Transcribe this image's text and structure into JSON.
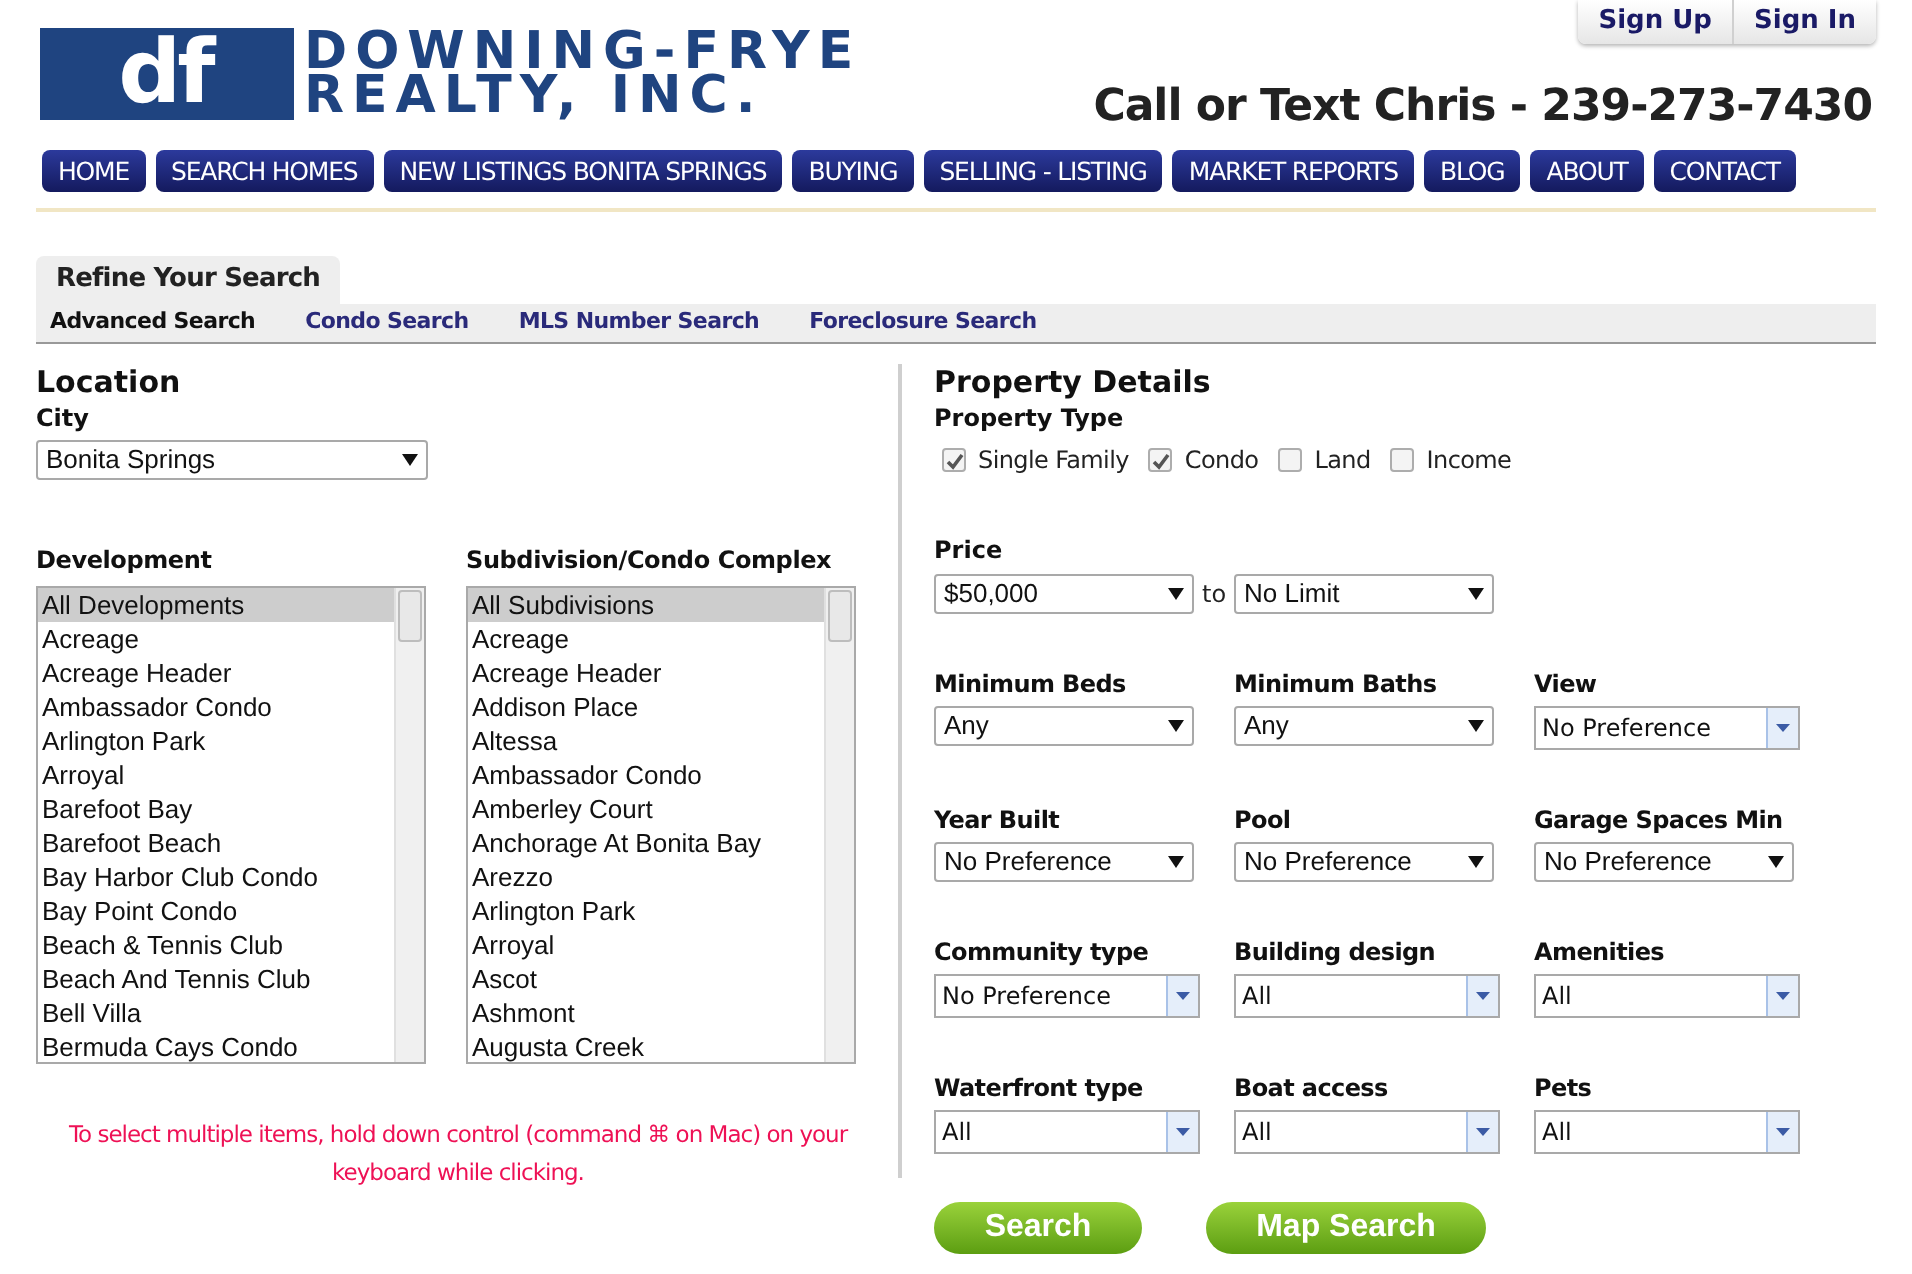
{
  "logo": {
    "mark": "df",
    "name_line_1": "DOWNING-FRYE",
    "name_line_2": "REALTY, INC."
  },
  "account_links": [
    "Sign Up",
    "Sign In"
  ],
  "phone": "Call or Text Chris - 239-273-7430",
  "nav": [
    "HOME",
    "SEARCH HOMES",
    "NEW LISTINGS BONITA SPRINGS",
    "BUYING",
    "SELLING - LISTING",
    "MARKET REPORTS",
    "BLOG",
    "ABOUT",
    "CONTACT"
  ],
  "panel_tab": "Refine Your Search",
  "search_tabs": [
    {
      "label": "Advanced Search",
      "selected": true
    },
    {
      "label": "Condo Search",
      "selected": false
    },
    {
      "label": "MLS Number Search",
      "selected": false
    },
    {
      "label": "Foreclosure Search",
      "selected": false
    }
  ],
  "location": {
    "heading": "Location",
    "city_label": "City",
    "city_value": "Bonita Springs",
    "lists": [
      {
        "label": "Development",
        "items": [
          {
            "text": "All Developments",
            "selected": true
          },
          {
            "text": "Acreage",
            "selected": false
          },
          {
            "text": "Acreage Header",
            "selected": false
          },
          {
            "text": "Ambassador Condo",
            "selected": false
          },
          {
            "text": "Arlington Park",
            "selected": false
          },
          {
            "text": "Arroyal",
            "selected": false
          },
          {
            "text": "Barefoot Bay",
            "selected": false
          },
          {
            "text": "Barefoot Beach",
            "selected": false
          },
          {
            "text": "Bay Harbor Club Condo",
            "selected": false
          },
          {
            "text": "Bay Point Condo",
            "selected": false
          },
          {
            "text": "Beach & Tennis Club",
            "selected": false
          },
          {
            "text": "Beach And Tennis Club",
            "selected": false
          },
          {
            "text": "Bell Villa",
            "selected": false
          },
          {
            "text": "Bermuda Cays Condo",
            "selected": false
          }
        ]
      },
      {
        "label": "Subdivision/Condo Complex",
        "items": [
          {
            "text": "All Subdivisions",
            "selected": true
          },
          {
            "text": "Acreage",
            "selected": false
          },
          {
            "text": "Acreage Header",
            "selected": false
          },
          {
            "text": "Addison Place",
            "selected": false
          },
          {
            "text": "Altessa",
            "selected": false
          },
          {
            "text": "Ambassador Condo",
            "selected": false
          },
          {
            "text": "Amberley Court",
            "selected": false
          },
          {
            "text": "Anchorage At Bonita Bay",
            "selected": false
          },
          {
            "text": "Arezzo",
            "selected": false
          },
          {
            "text": "Arlington Park",
            "selected": false
          },
          {
            "text": "Arroyal",
            "selected": false
          },
          {
            "text": "Ascot",
            "selected": false
          },
          {
            "text": "Ashmont",
            "selected": false
          },
          {
            "text": "Augusta Creek",
            "selected": false
          }
        ]
      }
    ],
    "note": "To select multiple items, hold down control (command ⌘ on Mac) on your keyboard while clicking."
  },
  "details": {
    "heading": "Property Details",
    "type_label": "Property Type",
    "types": [
      {
        "label": "Single Family",
        "checked": true
      },
      {
        "label": "Condo",
        "checked": true
      },
      {
        "label": "Land",
        "checked": false
      },
      {
        "label": "Income",
        "checked": false
      }
    ],
    "price_label": "Price",
    "price_min": "$50,000",
    "price_sep": "to",
    "price_max": "No Limit",
    "rows": [
      [
        {
          "label": "Minimum Beds",
          "value": "Any",
          "kind": "native"
        },
        {
          "label": "Minimum Baths",
          "value": "Any",
          "kind": "native"
        },
        {
          "label": "View",
          "value": "No Preference",
          "kind": "combo"
        }
      ],
      [
        {
          "label": "Year Built",
          "value": "No Preference",
          "kind": "native"
        },
        {
          "label": "Pool",
          "value": "No Preference",
          "kind": "native"
        },
        {
          "label": "Garage Spaces Min",
          "value": "No Preference",
          "kind": "native"
        }
      ],
      [
        {
          "label": "Community type",
          "value": "No Preference",
          "kind": "combo"
        },
        {
          "label": "Building design",
          "value": "All",
          "kind": "combo"
        },
        {
          "label": "Amenities",
          "value": "All",
          "kind": "combo"
        }
      ],
      [
        {
          "label": "Waterfront type",
          "value": "All",
          "kind": "combo"
        },
        {
          "label": "Boat access",
          "value": "All",
          "kind": "combo"
        },
        {
          "label": "Pets",
          "value": "All",
          "kind": "combo"
        }
      ]
    ],
    "buttons": [
      "Search",
      "Map Search"
    ]
  }
}
